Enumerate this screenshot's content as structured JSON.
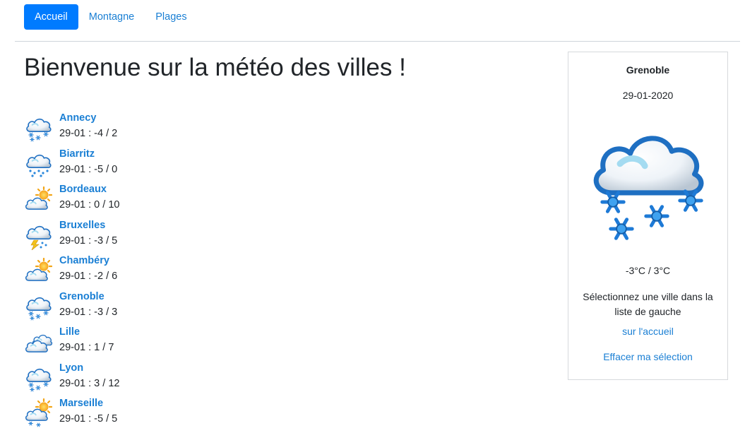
{
  "nav": {
    "items": [
      {
        "label": "Accueil",
        "active": true
      },
      {
        "label": "Montagne",
        "active": false
      },
      {
        "label": "Plages",
        "active": false
      }
    ]
  },
  "page_title": "Bienvenue sur la météo des villes !",
  "cities": [
    {
      "name": "Annecy",
      "temps": "29-01 : -4 / 2",
      "icon": "snow-cloud-icon"
    },
    {
      "name": "Biarritz",
      "temps": "29-01 : -5 / 0",
      "icon": "rain-cloud-icon"
    },
    {
      "name": "Bordeaux",
      "temps": "29-01 : 0 / 10",
      "icon": "sun-cloud-icon"
    },
    {
      "name": "Bruxelles",
      "temps": "29-01 : -3 / 5",
      "icon": "storm-cloud-icon"
    },
    {
      "name": "Chambéry",
      "temps": "29-01 : -2 / 6",
      "icon": "sun-cloud-icon"
    },
    {
      "name": "Grenoble",
      "temps": "29-01 : -3 / 3",
      "icon": "snow-cloud-icon"
    },
    {
      "name": "Lille",
      "temps": "29-01 : 1 / 7",
      "icon": "cloudy-icon"
    },
    {
      "name": "Lyon",
      "temps": "29-01 : 3 / 12",
      "icon": "snow-cloud-icon"
    },
    {
      "name": "Marseille",
      "temps": "29-01 : -5 / 5",
      "icon": "sun-snow-cloud-icon"
    }
  ],
  "panel": {
    "city": "Grenoble",
    "date": "29-01-2020",
    "icon": "snow-cloud-icon",
    "temps": "-3°C / 3°C",
    "message": "Sélectionnez une ville dans la liste de gauche",
    "link_home": "sur l'accueil",
    "link_clear": "Effacer ma sélection"
  },
  "colors": {
    "accent": "#007bff",
    "link": "#1a7fd4",
    "text": "#212529"
  }
}
